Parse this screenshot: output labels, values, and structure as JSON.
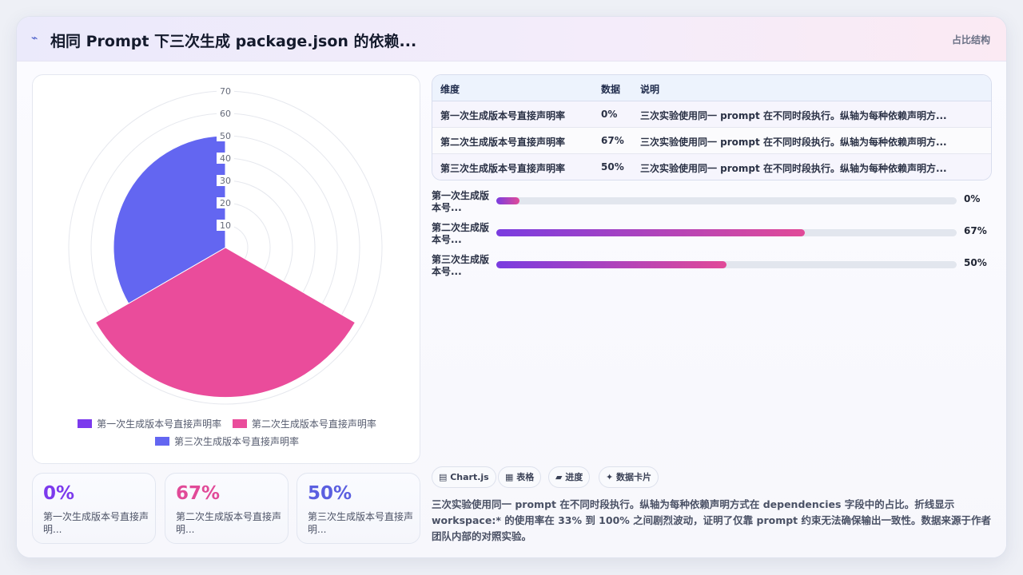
{
  "header": {
    "icon": "sparkle-icon",
    "title": "相同 Prompt 下三次生成 package.json 的依赖...",
    "tag": "占比结构"
  },
  "chart_data": {
    "type": "polarArea",
    "categories": [
      "第一次生成版本号直接声明率",
      "第二次生成版本号直接声明率",
      "第三次生成版本号直接声明率"
    ],
    "values": [
      0,
      67,
      50
    ],
    "colors": [
      "#7c3aed",
      "#ea4c9b",
      "#6366f1"
    ],
    "r_ticks": [
      "10",
      "20",
      "30",
      "40",
      "50",
      "60",
      "70"
    ],
    "rlim": [
      0,
      70
    ]
  },
  "legend": {
    "items": [
      {
        "label": "第一次生成版本号直接声明率",
        "color": "#7c3aed"
      },
      {
        "label": "第二次生成版本号直接声明率",
        "color": "#ea4c9b"
      },
      {
        "label": "第三次生成版本号直接声明率",
        "color": "#6366f1"
      }
    ]
  },
  "stats": [
    {
      "value": "0%",
      "label": "第一次生成版本号直接声明...",
      "color": "#7c3aed"
    },
    {
      "value": "67%",
      "label": "第二次生成版本号直接声明...",
      "color": "#e14a98"
    },
    {
      "value": "50%",
      "label": "第三次生成版本号直接声明...",
      "color": "#5b5fe0"
    }
  ],
  "table": {
    "headers": [
      "维度",
      "数据",
      "说明"
    ],
    "rows": [
      [
        "第一次生成版本号直接声明率",
        "0%",
        "三次实验使用同一 prompt 在不同时段执行。纵轴为每种依赖声明方..."
      ],
      [
        "第二次生成版本号直接声明率",
        "67%",
        "三次实验使用同一 prompt 在不同时段执行。纵轴为每种依赖声明方..."
      ],
      [
        "第三次生成版本号直接声明率",
        "50%",
        "三次实验使用同一 prompt 在不同时段执行。纵轴为每种依赖声明方..."
      ]
    ]
  },
  "progress": [
    {
      "label": "第一次生成版本号...",
      "value_text": "0%",
      "fraction": 0.0
    },
    {
      "label": "第二次生成版本号...",
      "value_text": "67%",
      "fraction": 0.67
    },
    {
      "label": "第三次生成版本号...",
      "value_text": "50%",
      "fraction": 0.5
    }
  ],
  "chips": [
    {
      "label": "▤ Chart.js"
    },
    {
      "label": "▦ 表格"
    },
    {
      "label": "▰ 进度"
    },
    {
      "label": "✦ 数据卡片"
    }
  ],
  "description": "三次实验使用同一 prompt 在不同时段执行。纵轴为每种依赖声明方式在 dependencies 字段中的占比。折线显示 workspace:* 的使用率在 33% 到 100% 之间剧烈波动，证明了仅靠 prompt 约束无法确保输出一致性。数据来源于作者团队内部的对照实验。"
}
